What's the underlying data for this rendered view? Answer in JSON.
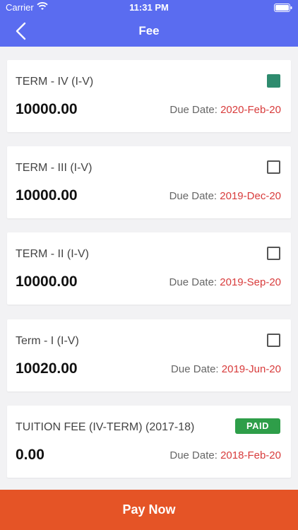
{
  "status_bar": {
    "carrier": "Carrier",
    "time": "11:31 PM",
    "icons": [
      "wifi-icon",
      "battery-icon"
    ]
  },
  "nav": {
    "title": "Fee",
    "back_icon": "chevron-left-icon"
  },
  "colors": {
    "header": "#5a6cf0",
    "pay_button": "#e55426",
    "due_date": "#d83b3b",
    "checked": "#2e8b6e",
    "paid_badge": "#2e9e49"
  },
  "fees": [
    {
      "name": "TERM - IV (I-V)",
      "amount": "10000.00",
      "due_label": "Due Date:",
      "due_date": "2020-Feb-20",
      "status": "checked"
    },
    {
      "name": "TERM - III (I-V)",
      "amount": "10000.00",
      "due_label": "Due Date:",
      "due_date": "2019-Dec-20",
      "status": "unchecked"
    },
    {
      "name": "TERM - II (I-V)",
      "amount": "10000.00",
      "due_label": "Due Date:",
      "due_date": "2019-Sep-20",
      "status": "unchecked"
    },
    {
      "name": "Term - I (I-V)",
      "amount": "10020.00",
      "due_label": "Due Date:",
      "due_date": "2019-Jun-20",
      "status": "unchecked"
    },
    {
      "name": "TUITION FEE (IV-TERM) (2017-18)",
      "amount": "0.00",
      "due_label": "Due Date:",
      "due_date": "2018-Feb-20",
      "status": "paid",
      "badge": "PAID"
    }
  ],
  "pay_button": {
    "label": "Pay Now"
  }
}
